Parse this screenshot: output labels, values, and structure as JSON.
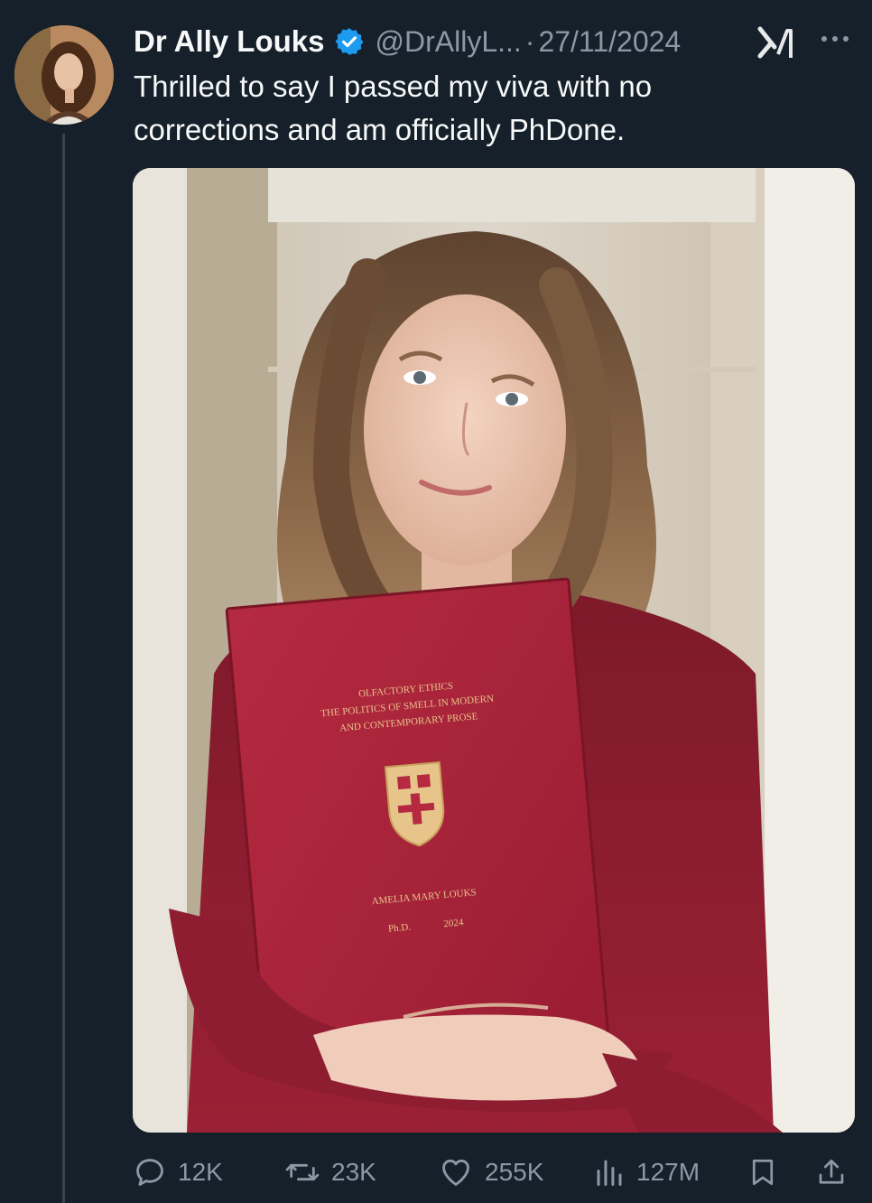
{
  "tweet": {
    "display_name": "Dr Ally Louks",
    "handle": "@DrAllyL...",
    "separator": "·",
    "date": "27/11/2024",
    "text_lines": [
      "Thrilled to say I passed my viva with no",
      "corrections and am officially PhDone."
    ],
    "verified": true
  },
  "media": {
    "thesis_cover": {
      "title_line1": "OLFACTORY ETHICS",
      "title_line2": "THE POLITICS OF SMELL IN MODERN",
      "title_line3": "AND CONTEMPORARY PROSE",
      "author": "AMELIA MARY LOUKS",
      "degree": "Ph.D.",
      "year": "2024"
    }
  },
  "actions": {
    "replies": "12K",
    "reposts": "23K",
    "likes": "255K",
    "views": "127M"
  },
  "icons": {
    "verified": "verified-badge-icon",
    "grok": "grok-icon",
    "more": "more-icon",
    "reply": "reply-icon",
    "repost": "repost-icon",
    "like": "heart-icon",
    "views": "views-icon",
    "bookmark": "bookmark-icon",
    "share": "share-icon"
  },
  "colors": {
    "background": "#15202b",
    "text": "#f7f9f9",
    "muted": "#8b98a5",
    "verified": "#1d9bf0",
    "thesis_cover": "#a71f36",
    "thesis_gold": "#e6c48a"
  }
}
